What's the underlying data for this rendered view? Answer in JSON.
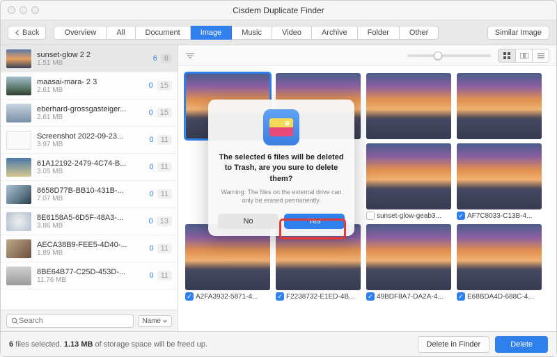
{
  "window": {
    "title": "Cisdem Duplicate Finder"
  },
  "toolbar": {
    "back": "Back",
    "tabs": [
      "Overview",
      "All",
      "Document",
      "Image",
      "Music",
      "Video",
      "Archive",
      "Folder",
      "Other"
    ],
    "active_tab": 3,
    "similar": "Similar Image"
  },
  "sidebar": {
    "items": [
      {
        "name": "sunset-glow 2 2",
        "size": "1.51 MB",
        "sel": 6,
        "total": 8,
        "thumb": "t1",
        "selected": true
      },
      {
        "name": "maasai-mara- 2 3",
        "size": "2.61 MB",
        "sel": 0,
        "total": 15,
        "thumb": "t2"
      },
      {
        "name": "eberhard-grossgasteiger...",
        "size": "2.61 MB",
        "sel": 0,
        "total": 15,
        "thumb": "t3"
      },
      {
        "name": "Screenshot 2022-09-23...",
        "size": "3.97 MB",
        "sel": 0,
        "total": 11,
        "thumb": "t4"
      },
      {
        "name": "61A12192-2479-4C74-B...",
        "size": "3.05 MB",
        "sel": 0,
        "total": 11,
        "thumb": "t5"
      },
      {
        "name": "8658D77B-BB10-431B-...",
        "size": "7.07 MB",
        "sel": 0,
        "total": 11,
        "thumb": "t6"
      },
      {
        "name": "8E6158A5-6D5F-48A3-...",
        "size": "3.86 MB",
        "sel": 0,
        "total": 13,
        "thumb": "t7"
      },
      {
        "name": "AECA38B9-FEE5-4D40-...",
        "size": "1.89 MB",
        "sel": 0,
        "total": 11,
        "thumb": "t8"
      },
      {
        "name": "8BE64B77-C25D-453D-...",
        "size": "11.76 MB",
        "sel": 0,
        "total": 11,
        "thumb": "t9"
      }
    ],
    "search_placeholder": "Search",
    "sort_button": "Name"
  },
  "grid": {
    "cards": [
      {
        "name": "",
        "checked": false,
        "selected": true,
        "caption": false
      },
      {
        "name": "",
        "checked": false,
        "caption": false
      },
      {
        "name": "",
        "checked": false,
        "caption": false
      },
      {
        "name": "",
        "checked": false,
        "caption": false
      },
      {
        "name": "",
        "checked": false,
        "caption": false,
        "hidden": true
      },
      {
        "name": "",
        "checked": false,
        "caption": false,
        "hidden": true
      },
      {
        "name": "sunset-glow-geab3...",
        "checked": false
      },
      {
        "name": "AF7C8033-C13B-4...",
        "checked": true
      },
      {
        "name": "A2FA3932-5871-4...",
        "checked": true
      },
      {
        "name": "F2238732-E1ED-4B...",
        "checked": true
      },
      {
        "name": "49BDF8A7-DA2A-4...",
        "checked": true
      },
      {
        "name": "E68BDA4D-688C-4...",
        "checked": true
      }
    ]
  },
  "modal": {
    "title": "The selected 6 files will be deleted to Trash, are you sure to delete them?",
    "warning": "Warning: The files on the external drive can only be erased permanently.",
    "no": "No",
    "yes": "Yes"
  },
  "statusbar": {
    "count": "6",
    "mid1": " files selected. ",
    "size": "1.13 MB",
    "mid2": " of storage space will be freed up.",
    "delete_finder": "Delete in Finder",
    "delete": "Delete"
  }
}
